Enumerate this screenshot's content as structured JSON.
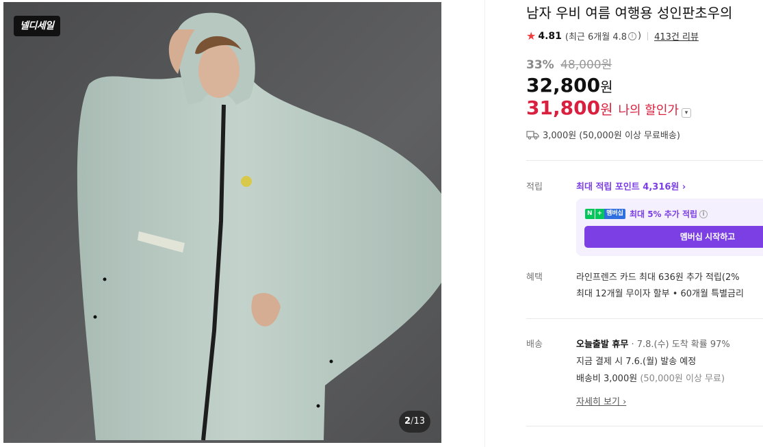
{
  "gallery": {
    "brand_badge": "넬디세일",
    "counter_current": "2",
    "counter_separator": "/",
    "counter_total": "13"
  },
  "product": {
    "title": "남자 우비 여름 여행용 성인판초우의",
    "rating_score": "4.81",
    "rating_recent_prefix": "(최근 6개월 4.8",
    "rating_recent_suffix": ")",
    "info_glyph": "i",
    "reviews_link": "413건 리뷰",
    "discount_percent": "33%",
    "original_price": "48,000원",
    "price": "32,800",
    "price_unit": "원",
    "my_price": "31,800",
    "my_price_unit": "원",
    "my_price_label": "나의 할인가",
    "shipping_text": "3,000원 (50,000원 이상 무료배송)"
  },
  "points": {
    "label": "적립",
    "max_points": "최대 적립 포인트 4,316원 ›",
    "npay_n": "N",
    "npay_plus": "+",
    "npay_member": "멤버십",
    "member_text": "최대 5% 추가 적립",
    "member_button": "멤버십 시작하고"
  },
  "benefits": {
    "label": "혜택",
    "line1": "라인프렌즈 카드 최대 636원 추가 적립(2%",
    "line2": "최대 12개월 무이자 할부 • 60개월 특별금리"
  },
  "delivery": {
    "label": "배송",
    "today_badge": "오늘출발 휴무",
    "arrival": "· 7.8.(수) 도착 확률 97%",
    "dispatch": "지금 결제 시 7.6.(월) 발송 예정",
    "fee": "배송비 3,000원",
    "fee_note": "(50,000원 이상 무료)",
    "detail_link": "자세히 보기 ›"
  },
  "colors": {
    "accent_purple": "#7b3fe4",
    "sale_red": "#d9213f",
    "star_red": "#f03e3e",
    "poncho": "#b9cbc3"
  }
}
